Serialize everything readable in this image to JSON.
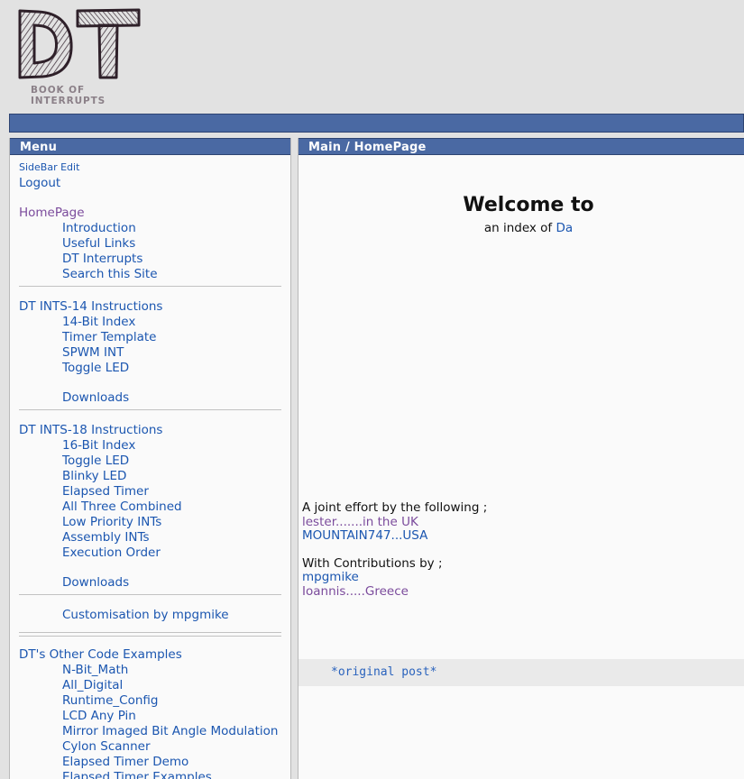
{
  "site": {
    "logo_letters": "DT",
    "logo_subtitle": "BOOK OF INTERRUPTS"
  },
  "colors": {
    "accent_blue": "#4a69a3",
    "accent_blue_border": "#2e4472",
    "link": "#1b56b0",
    "link_visited": "#7b4b9c",
    "page_bg": "#e2e2e2",
    "panel_bg": "#fafafa",
    "code_bg": "#eaeaea"
  },
  "sidebar": {
    "title": "Menu",
    "top_links": [
      {
        "label": "SideBar Edit",
        "style": "small",
        "visited": false
      },
      {
        "label": "Logout",
        "style": "normal",
        "visited": false
      }
    ],
    "sections": [
      {
        "heading": "HomePage",
        "heading_visited": true,
        "items": [
          "Introduction",
          "Useful Links",
          "DT Interrupts",
          "Search this Site"
        ]
      },
      {
        "heading": "DT INTS-14 Instructions",
        "heading_visited": false,
        "items": [
          "14-Bit Index",
          "Timer Template",
          "SPWM INT",
          "Toggle LED"
        ],
        "extra": "Downloads"
      },
      {
        "heading": "DT INTS-18 Instructions",
        "heading_visited": false,
        "items": [
          "16-Bit Index",
          "Toggle LED",
          "Blinky LED",
          "Elapsed Timer",
          "All Three Combined",
          "Low Priority INTs",
          "Assembly INTs",
          "Execution Order"
        ],
        "extra": "Downloads"
      }
    ],
    "customisation": "Customisation by mpgmike",
    "other_examples": {
      "heading": "DT's Other Code Examples",
      "items": [
        "N-Bit_Math",
        "All_Digital",
        "Runtime_Config",
        "LCD Any Pin",
        "Mirror Imaged Bit Angle Modulation",
        "Cylon Scanner",
        "Elapsed Timer Demo",
        "Elapsed Timer Examples"
      ]
    }
  },
  "main": {
    "title": "Main / HomePage",
    "welcome_heading": "Welcome to",
    "subtitle_prefix": "an index of ",
    "subtitle_link": "Da",
    "credits": {
      "joint_effort_label": "A joint effort by the following ;",
      "joint_effort": [
        {
          "name": "lester.......in the UK",
          "visited": true
        },
        {
          "name": "MOUNTAIN747...USA",
          "visited": false
        }
      ],
      "contributions_label": "With Contributions by ;",
      "contributions": [
        {
          "name": "mpgmike",
          "visited": false
        },
        {
          "name": "Ioannis.....Greece",
          "visited": true
        }
      ]
    },
    "code_line": "*original post*"
  }
}
